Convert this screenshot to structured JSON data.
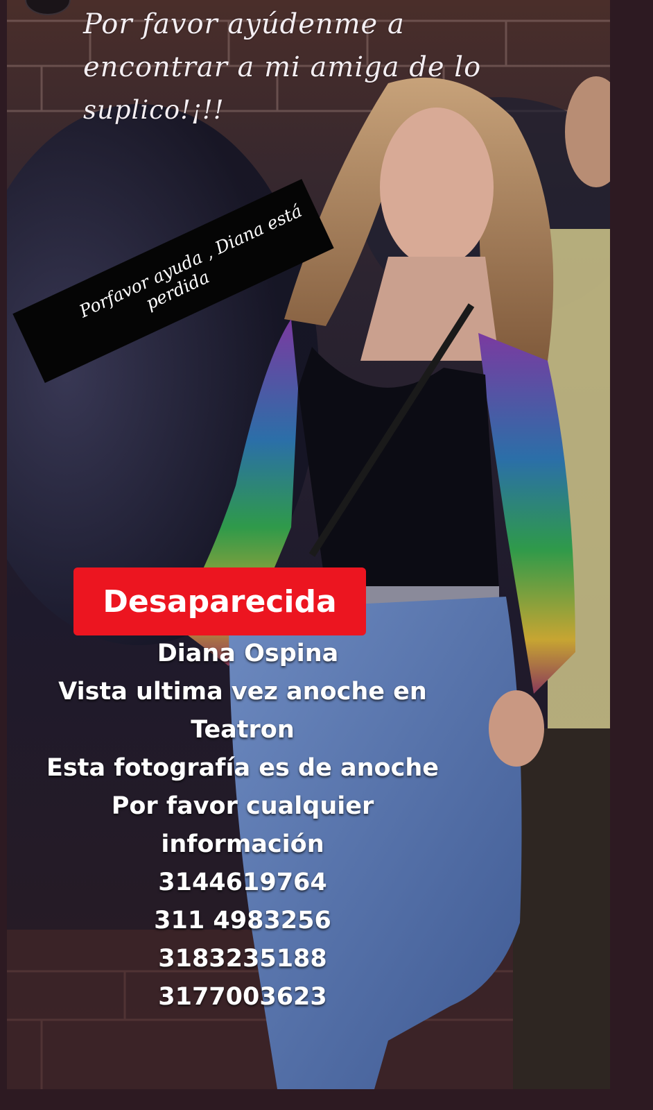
{
  "caption": {
    "line1": "Por favor ayúdenme a",
    "line2": "encontrar a mi amiga de lo",
    "line3": "suplico!¡!!"
  },
  "sticker": {
    "line1": "Porfavor ayuda , Diana está",
    "line2": "perdida"
  },
  "badge": "Desaparecida",
  "info": {
    "name": "Diana  Ospina",
    "seen1": "Vista ultima vez anoche en",
    "seen2": "Teatron",
    "photo_note": "Esta fotografía  es de anoche",
    "ask1": "Por favor cualquier",
    "ask2": "información",
    "phones": [
      "3144619764",
      "311 4983256",
      "3183235188",
      "3177003623"
    ]
  },
  "colors": {
    "badge_bg": "#ec1520",
    "sticker_bg": "#050505",
    "border": "#2d1a22"
  }
}
